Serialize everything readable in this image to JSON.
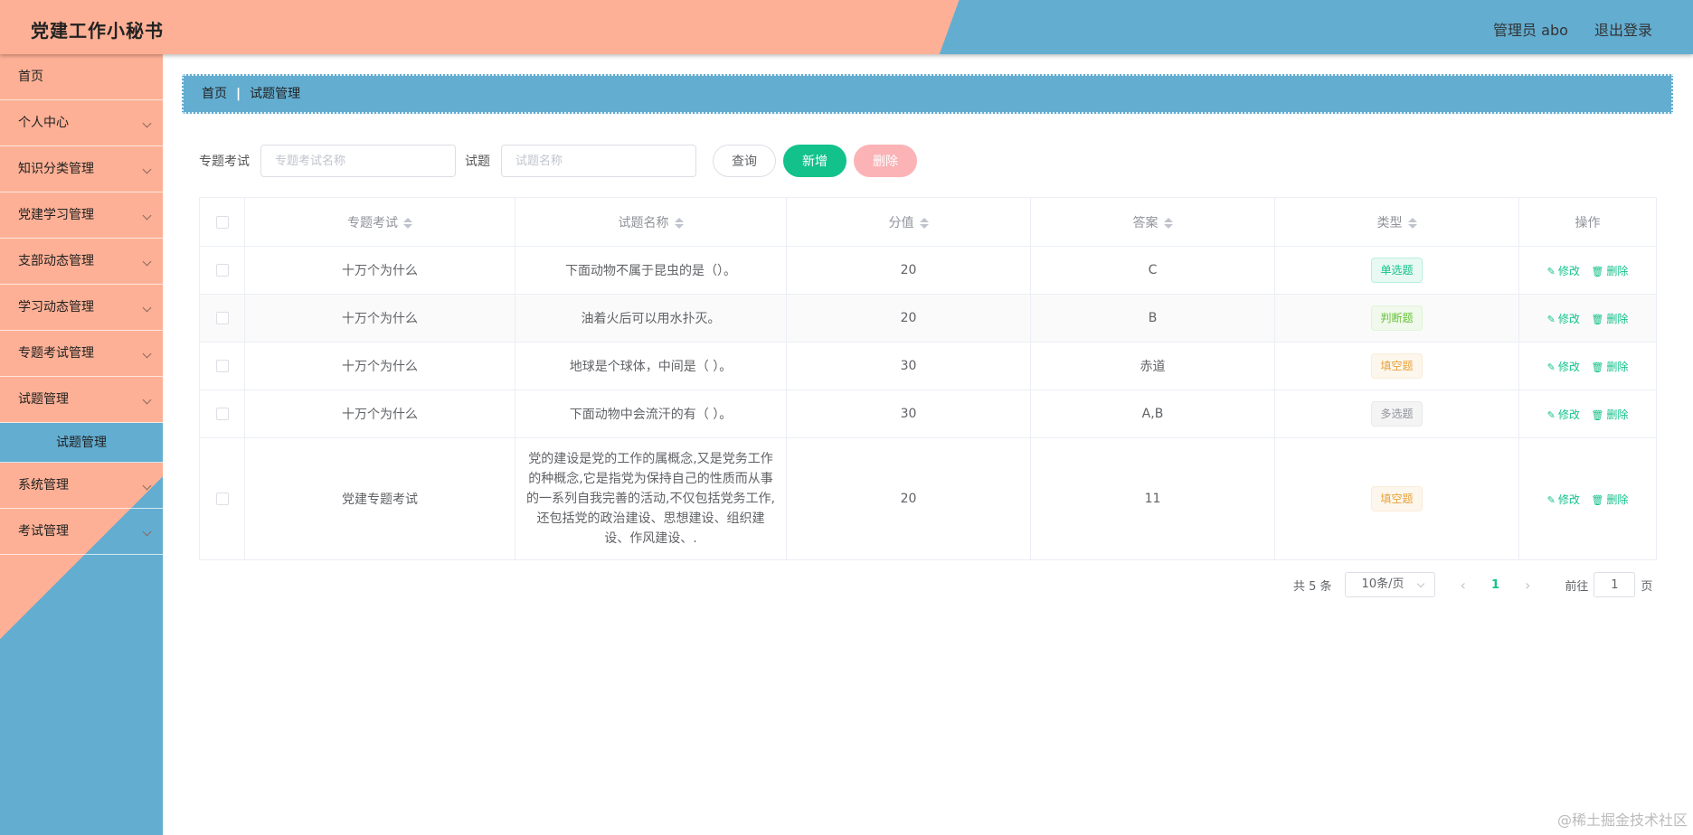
{
  "header": {
    "title": "党建工作小秘书",
    "user": "管理员 abo",
    "logout": "退出登录"
  },
  "sidebar": {
    "items": [
      {
        "label": "首页"
      },
      {
        "label": "个人中心"
      },
      {
        "label": "知识分类管理"
      },
      {
        "label": "党建学习管理"
      },
      {
        "label": "支部动态管理"
      },
      {
        "label": "学习动态管理"
      },
      {
        "label": "专题考试管理"
      },
      {
        "label": "试题管理"
      },
      {
        "label": "系统管理"
      },
      {
        "label": "考试管理"
      }
    ],
    "active_sub": "试题管理"
  },
  "breadcrumb": {
    "home": "首页",
    "sep": "|",
    "current": "试题管理"
  },
  "search": {
    "exam_label": "专题考试",
    "exam_placeholder": "专题考试名称",
    "question_label": "试题",
    "question_placeholder": "试题名称",
    "query": "查询",
    "add": "新增",
    "delete": "删除"
  },
  "table": {
    "headers": [
      "专题考试",
      "试题名称",
      "分值",
      "答案",
      "类型",
      "操作"
    ],
    "rows": [
      {
        "exam": "十万个为什么",
        "name": "下面动物不属于昆虫的是（）。",
        "score": "20",
        "answer": "C",
        "type": "单选题"
      },
      {
        "exam": "十万个为什么",
        "name": "油着火后可以用水扑灭。",
        "score": "20",
        "answer": "B",
        "type": "判断题"
      },
      {
        "exam": "十万个为什么",
        "name": "地球是个球体，中间是（ ）。",
        "score": "30",
        "answer": "赤道",
        "type": "填空题"
      },
      {
        "exam": "十万个为什么",
        "name": "下面动物中会流汗的有（ ）。",
        "score": "30",
        "answer": "A,B",
        "type": "多选题"
      },
      {
        "exam": "党建专题考试",
        "name": "党的建设是党的工作的属概念,又是党务工作的种概念,它是指党为保持自己的性质而从事的一系列自我完善的活动,不仅包括党务工作,还包括党的政治建设、思想建设、组织建设、作风建设、.",
        "score": "20",
        "answer": "11",
        "type": "填空题"
      }
    ],
    "edit": "修改",
    "remove": "删除"
  },
  "pager": {
    "total": "共 5 条",
    "size": "10条/页",
    "prev": "‹",
    "page": "1",
    "next": "›",
    "goto": "前往",
    "goto_value": "1",
    "page_unit": "页"
  },
  "watermark": "@稀土掘金技术社区"
}
